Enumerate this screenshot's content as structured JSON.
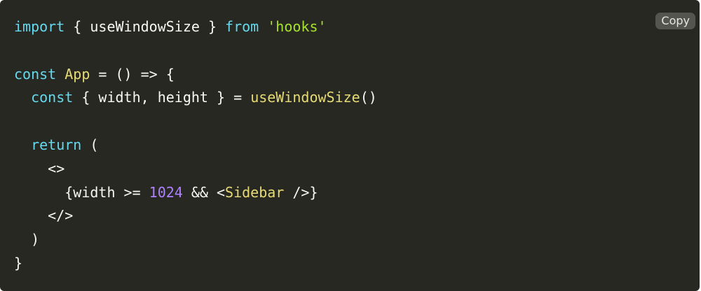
{
  "copy_button": {
    "label": "Copy"
  },
  "code": {
    "language": "jsx",
    "colors": {
      "background": "#272822",
      "keyword": "#66d9ef",
      "string": "#a6e22e",
      "function": "#e6db74",
      "number": "#ae81ff",
      "text": "#f8f8f2"
    },
    "lines": [
      [
        {
          "t": "import",
          "c": "kw"
        },
        {
          "t": " { useWindowSize } ",
          "c": "plain"
        },
        {
          "t": "from",
          "c": "kw"
        },
        {
          "t": " ",
          "c": "plain"
        },
        {
          "t": "'hooks'",
          "c": "str"
        }
      ],
      [],
      [
        {
          "t": "const",
          "c": "kw"
        },
        {
          "t": " ",
          "c": "plain"
        },
        {
          "t": "App",
          "c": "fn"
        },
        {
          "t": " = () => {",
          "c": "plain"
        }
      ],
      [
        {
          "t": "  ",
          "c": "plain"
        },
        {
          "t": "const",
          "c": "kw"
        },
        {
          "t": " { width, height } = ",
          "c": "plain"
        },
        {
          "t": "useWindowSize",
          "c": "fn"
        },
        {
          "t": "()",
          "c": "plain"
        }
      ],
      [],
      [
        {
          "t": "  ",
          "c": "plain"
        },
        {
          "t": "return",
          "c": "kw"
        },
        {
          "t": " (",
          "c": "plain"
        }
      ],
      [
        {
          "t": "    <>",
          "c": "plain"
        }
      ],
      [
        {
          "t": "      {width >= ",
          "c": "plain"
        },
        {
          "t": "1024",
          "c": "num"
        },
        {
          "t": " && <",
          "c": "plain"
        },
        {
          "t": "Sidebar",
          "c": "fn"
        },
        {
          "t": " />}",
          "c": "plain"
        }
      ],
      [
        {
          "t": "    </>",
          "c": "plain"
        }
      ],
      [
        {
          "t": "  )",
          "c": "plain"
        }
      ],
      [
        {
          "t": "}",
          "c": "plain"
        }
      ]
    ]
  }
}
